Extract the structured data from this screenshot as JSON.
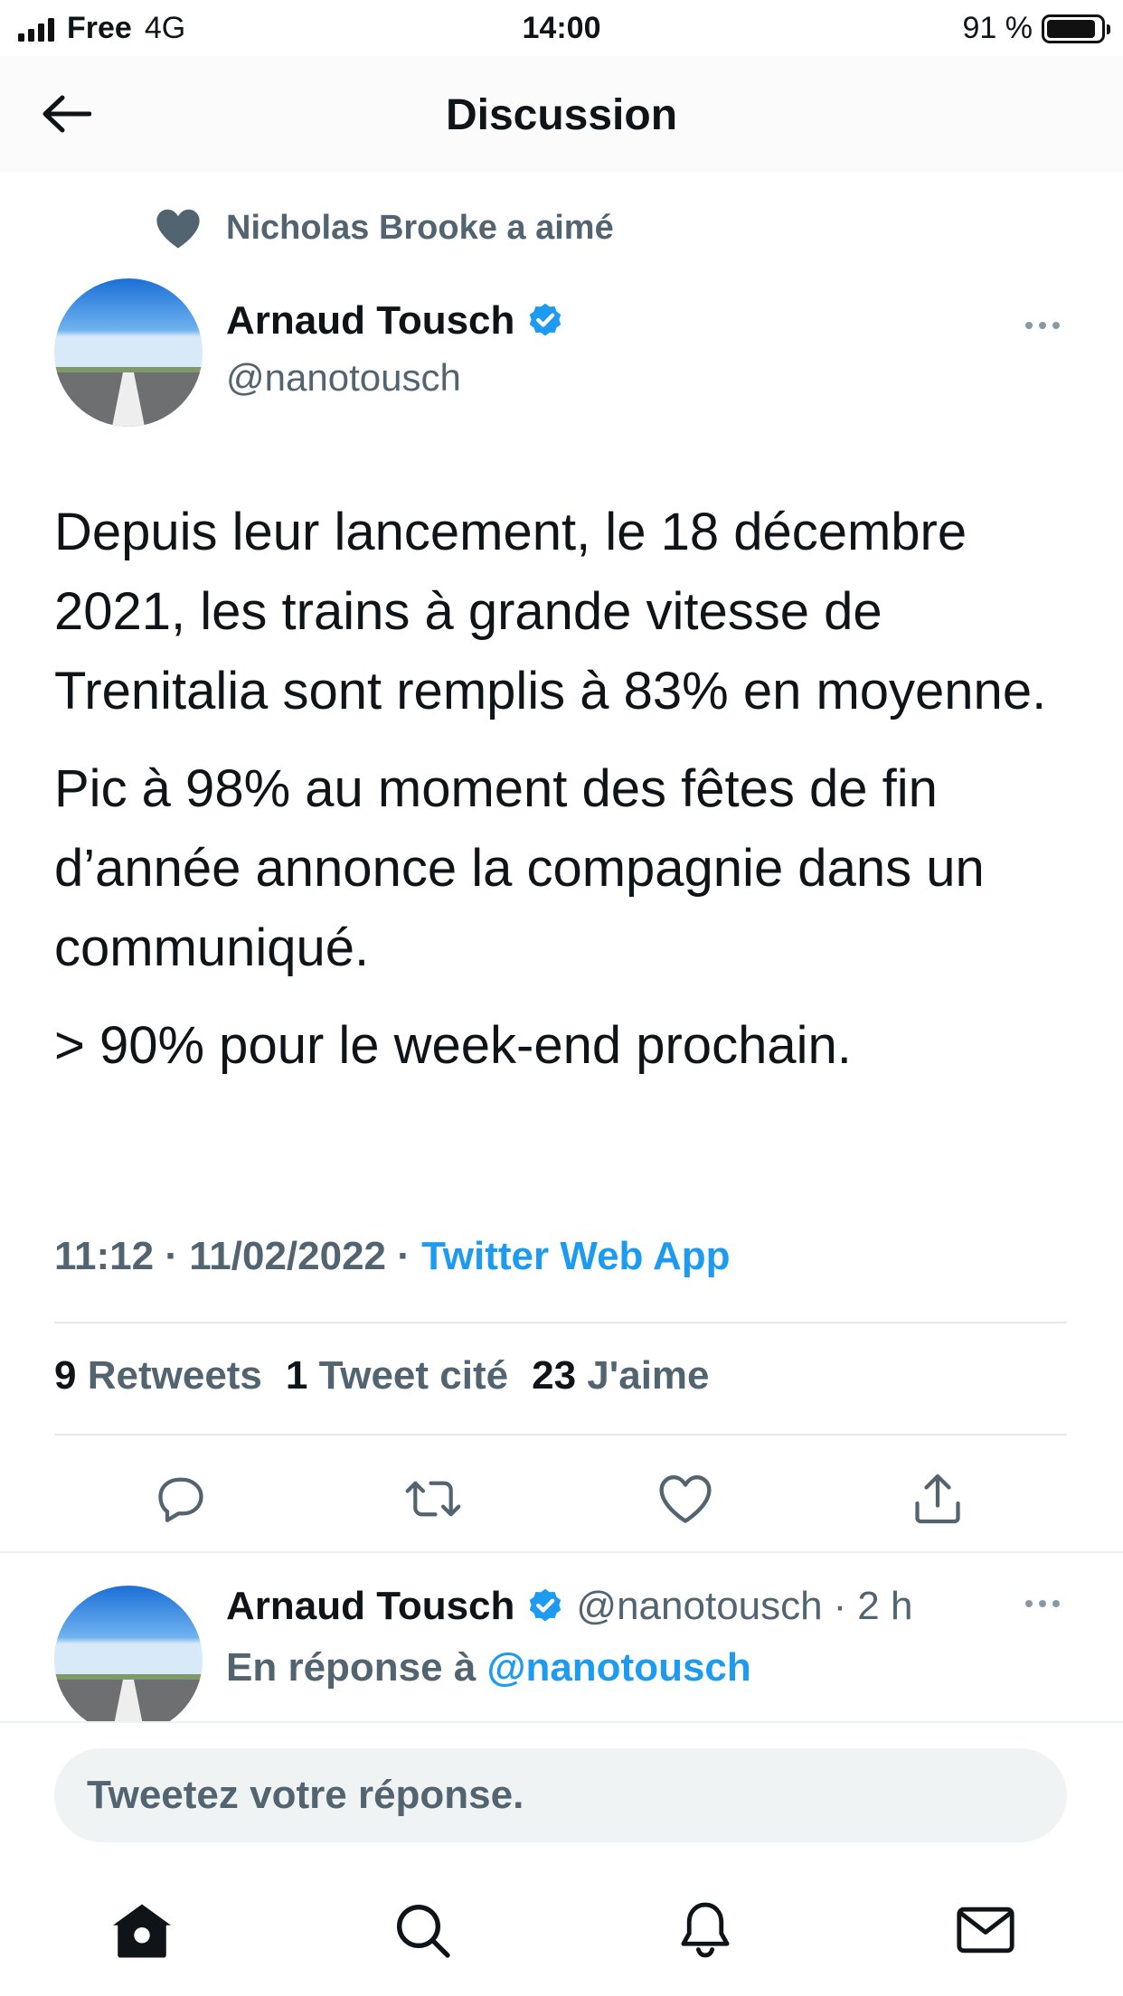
{
  "status_bar": {
    "carrier": "Free",
    "network": "4G",
    "time": "14:00",
    "battery": "91 %",
    "battery_level": 0.91
  },
  "header": {
    "title": "Discussion"
  },
  "social_context": {
    "text": "Nicholas Brooke a aimé"
  },
  "tweet": {
    "author_name": "Arnaud Tousch",
    "handle": "@nanotousch",
    "paragraphs": [
      "Depuis leur lancement, le 18 décembre 2021, les trains à grande vitesse de Trenitalia sont remplis à 83% en moyenne.",
      "Pic à 98% au moment des fêtes de fin d’année annonce la compagnie dans un communiqué.",
      "> 90% pour le week-end prochain."
    ],
    "time": "11:12",
    "date": "11/02/2022",
    "separator": "·",
    "source": "Twitter Web App",
    "stats": {
      "retweets_count": "9",
      "retweets_label": "Retweets",
      "quotes_count": "1",
      "quotes_label": "Tweet cité",
      "likes_count": "23",
      "likes_label": "J'aime"
    }
  },
  "reply": {
    "author_name": "Arnaud Tousch",
    "handle": "@nanotousch",
    "separator": "·",
    "age": "2 h",
    "reply_prefix": "En réponse à",
    "reply_to": "@nanotousch"
  },
  "compose": {
    "placeholder": "Tweetez votre réponse."
  },
  "icons": {
    "back": "arrow-left-icon",
    "liked": "heart-filled-icon",
    "verified": "verified-badge-icon",
    "more": "more-horizontal-icon",
    "reply": "comment-icon",
    "retweet": "retweet-icon",
    "like": "heart-outline-icon",
    "share": "share-icon",
    "home": "home-icon",
    "search": "search-icon",
    "notifications": "bell-icon",
    "messages": "mail-icon"
  },
  "colors": {
    "accent": "#1d9bf0",
    "secondary_text": "#536471",
    "primary_text": "#0f1419"
  }
}
